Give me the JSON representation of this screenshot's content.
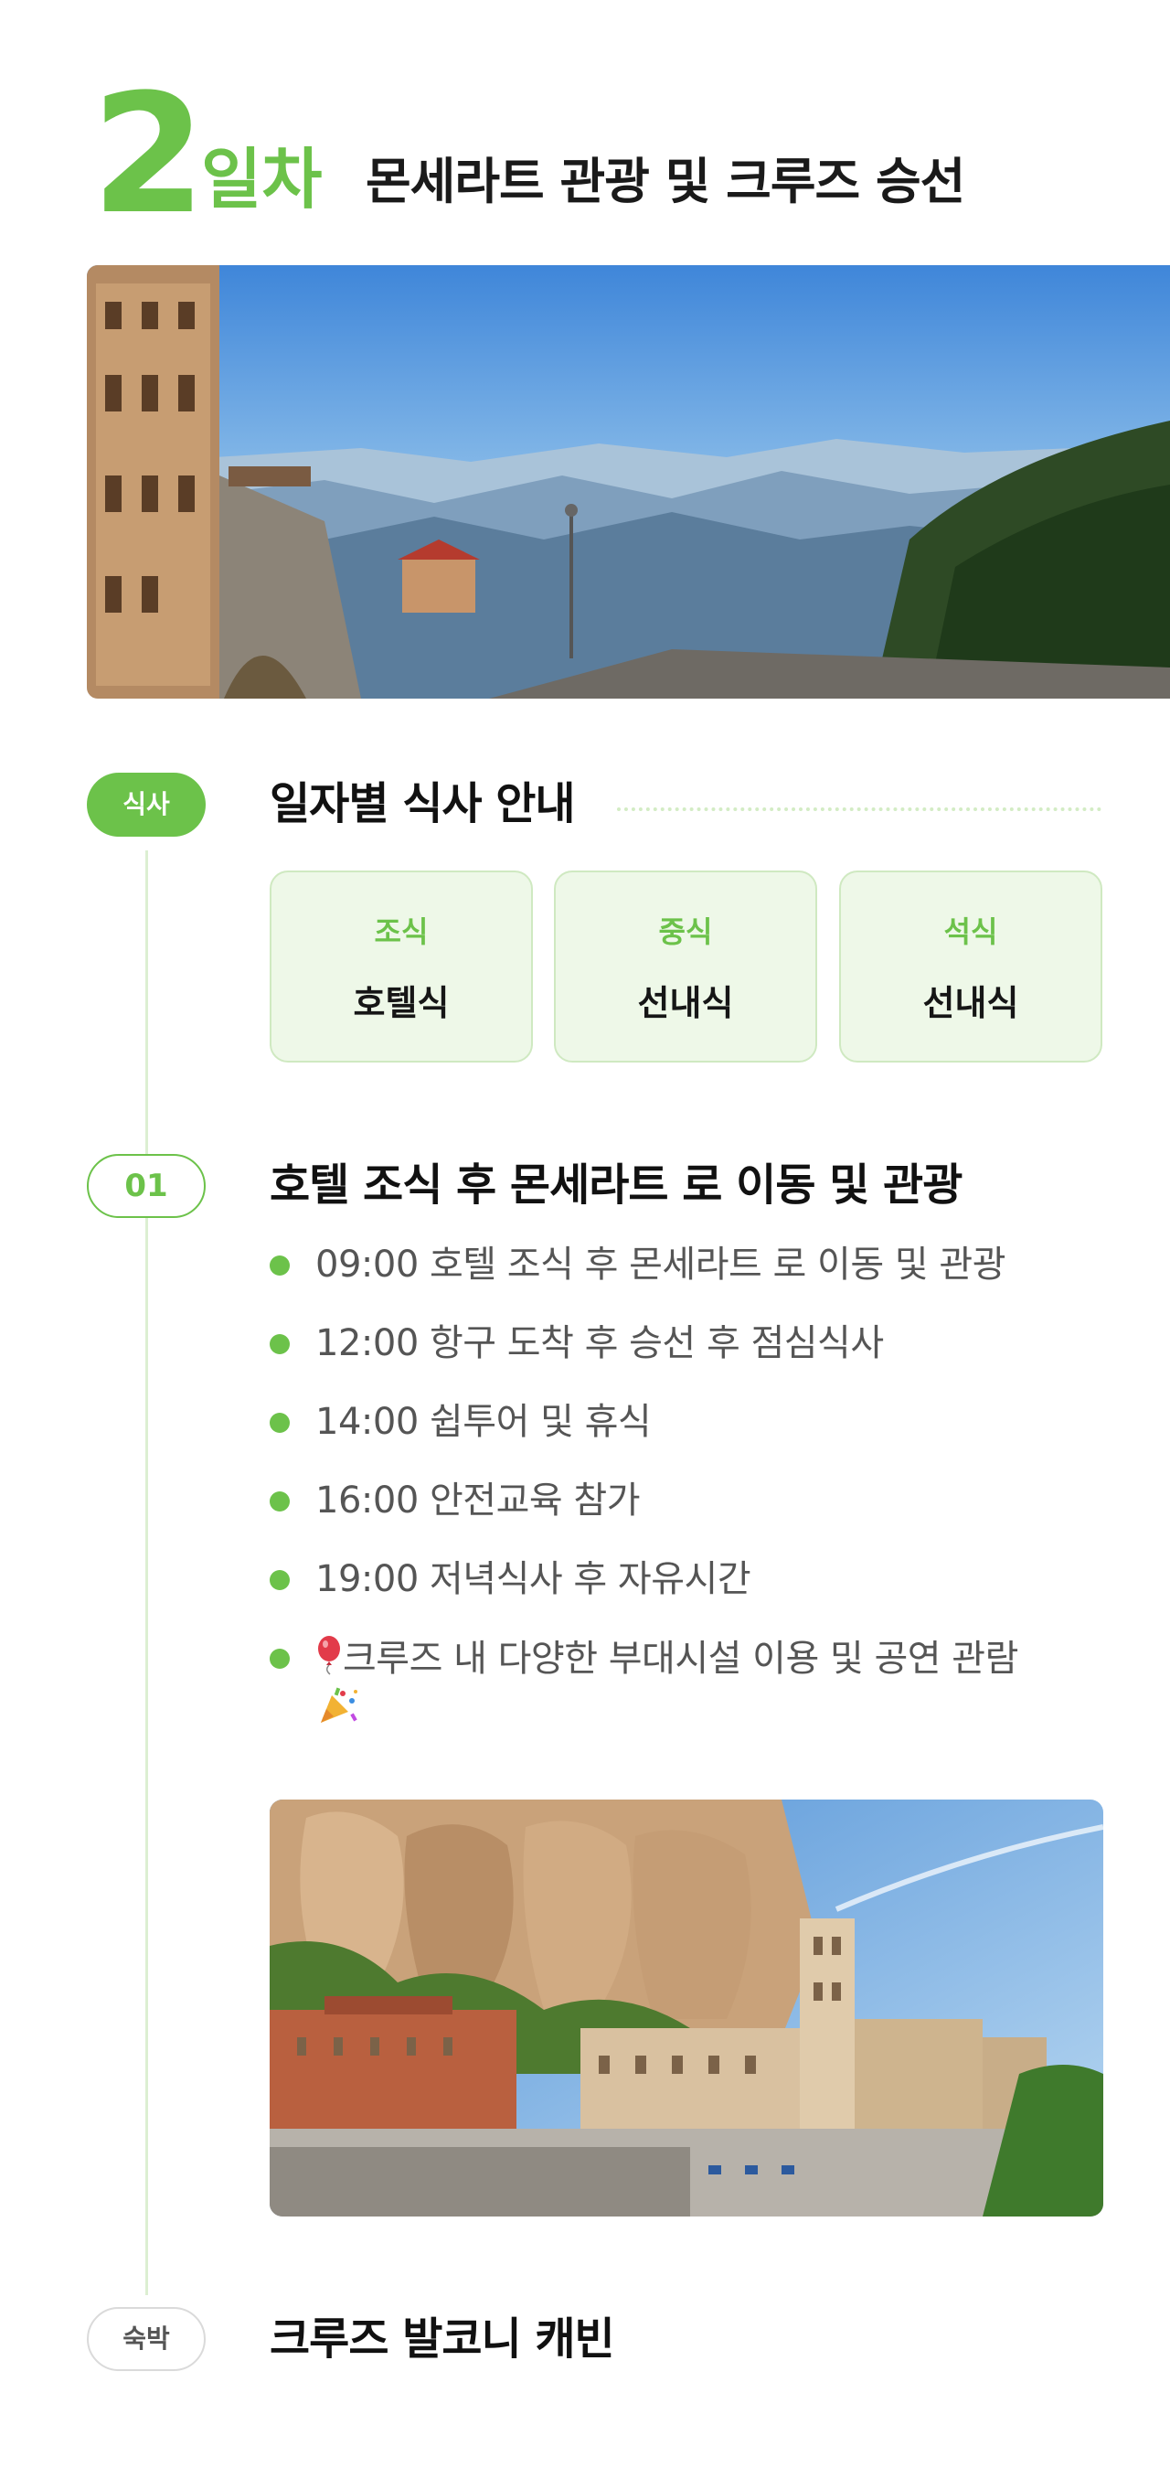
{
  "day": {
    "number": "2",
    "suffix": "일차",
    "title": "몬세라트 관광 및 크루즈 승선"
  },
  "meals": {
    "badge": "식사",
    "title": "일자별 식사 안내",
    "cards": [
      {
        "label": "조식",
        "value": "호텔식"
      },
      {
        "label": "중식",
        "value": "선내식"
      },
      {
        "label": "석식",
        "value": "선내식"
      }
    ]
  },
  "schedule": {
    "badge": "01",
    "title": "호텔 조식 후 몬세라트 로 이동 및 관광",
    "items": [
      "09:00 호텔 조식 후 몬세라트 로 이동 및 관광",
      "12:00 항구 도착 후 승선 후 점심식사",
      "14:00 쉽투어 및 휴식",
      "16:00 안전교육 참가",
      "19:00 저녁식사 후 자유시간",
      "크루즈 내 다양한 부대시설 이용 및 공연 관람"
    ]
  },
  "stay": {
    "badge": "숙박",
    "title": "크루즈 발코니 캐빈"
  },
  "colors": {
    "accent": "#6cc24a",
    "card_bg": "#eef8e8",
    "text": "#161616",
    "muted": "#555555"
  },
  "icons": [
    "balloon-icon",
    "party-popper-icon"
  ]
}
